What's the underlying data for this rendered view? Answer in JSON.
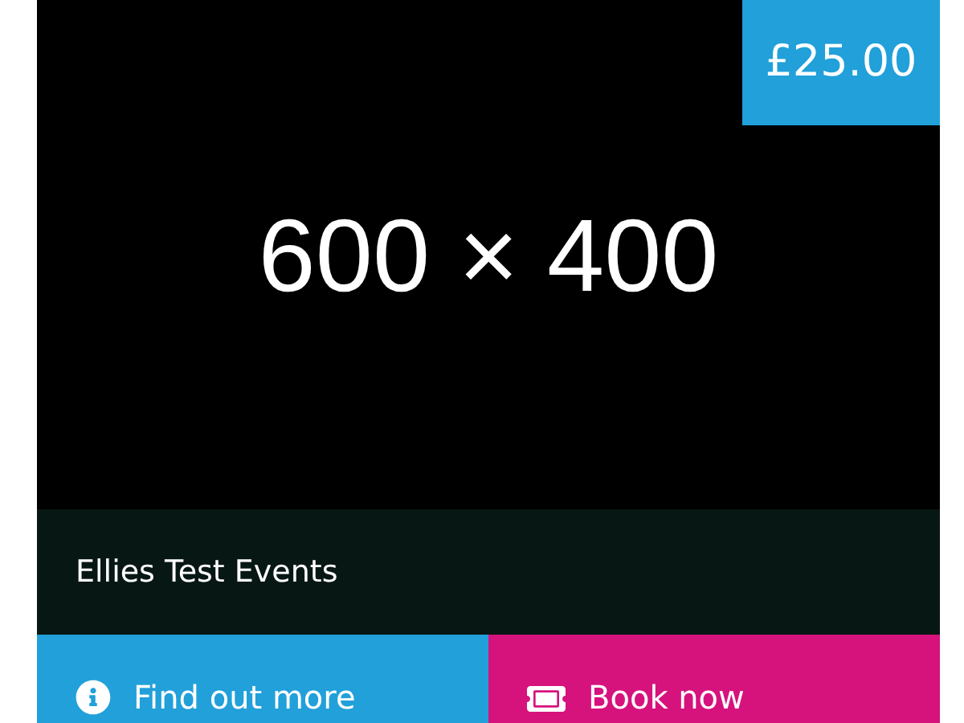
{
  "image": {
    "label": "600 × 400"
  },
  "price": "£25.00",
  "title": "Ellies Test Events",
  "buttons": [
    {
      "kind": "info",
      "label": "Find out more"
    },
    {
      "kind": "ticket",
      "label": "Book now"
    }
  ]
}
